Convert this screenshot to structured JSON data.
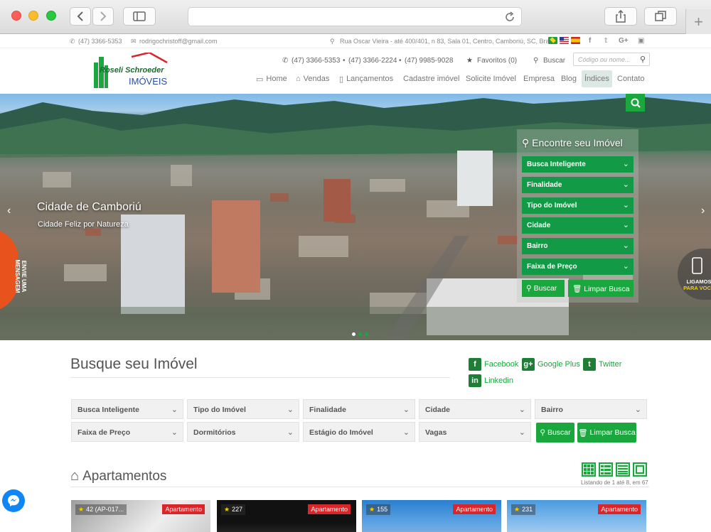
{
  "topbar": {
    "phone": "(47) 3366-5353",
    "email": "rodrigochristoff@gmail.com",
    "address": "Rua Oscar Vieira - até 400/401, n 83, Sala 01, Centro, Camboriú, SC, Brasil",
    "social": [
      "facebook-icon",
      "twitter-icon",
      "google-plus-icon",
      "youtube-icon"
    ]
  },
  "logo": {
    "line1": "Roseli Schroeder",
    "line2": "IMÓVEIS"
  },
  "header": {
    "phones": [
      "(47) 3366-5353",
      "(47) 3366-2224",
      "(47) 9985-9028"
    ],
    "favorites": "Favoritos (0)",
    "search_label": "Buscar",
    "search_placeholder": "Código ou nome..."
  },
  "nav": [
    "Home",
    "Vendas",
    "Lançamentos",
    "Cadastre imóvel",
    "Solicite Imóvel",
    "Empresa",
    "Blog",
    "Índices",
    "Contato"
  ],
  "hero": {
    "title": "Cidade de Camboriú",
    "subtitle": "Cidade Feliz por Natureza",
    "messenger_tab": [
      "ENVIE UMA",
      "MENSAGEM"
    ],
    "ligamos": [
      "LIGAMOS",
      "PARA VOCÊ"
    ]
  },
  "finder": {
    "title": "Encontre seu Imóvel",
    "fields": [
      "Busca Inteligente",
      "Finalidade",
      "Tipo do Imóvel",
      "Cidade",
      "Bairro",
      "Faixa de Preço"
    ],
    "search_btn": "Buscar",
    "clear_btn": "Limpar Busca"
  },
  "search": {
    "title": "Busque seu Imóvel",
    "row1": [
      "Busca Inteligente",
      "Tipo do Imóvel",
      "Finalidade",
      "Cidade",
      "Bairro"
    ],
    "row2": [
      "Faixa de Preço",
      "Dormitórios",
      "Estágio do Imóvel",
      "Vagas"
    ],
    "search_btn": "Buscar",
    "clear_btn": "Limpar Busca"
  },
  "social_links": [
    "Facebook",
    "Google Plus",
    "Twitter",
    "Linkedin"
  ],
  "apartments": {
    "title": "Apartamentos",
    "listing": "Listando de 1 até 8, em 67",
    "cards": [
      {
        "num": "42 (AP-017...",
        "type": "Apartamento"
      },
      {
        "num": "227",
        "type": "Apartamento"
      },
      {
        "num": "155",
        "type": "Apartamento"
      },
      {
        "num": "231",
        "type": "Apartamento"
      }
    ]
  },
  "colors": {
    "accent": "#1aa73d",
    "badge_red": "#d9262b",
    "messenger": "#0e86f6"
  }
}
